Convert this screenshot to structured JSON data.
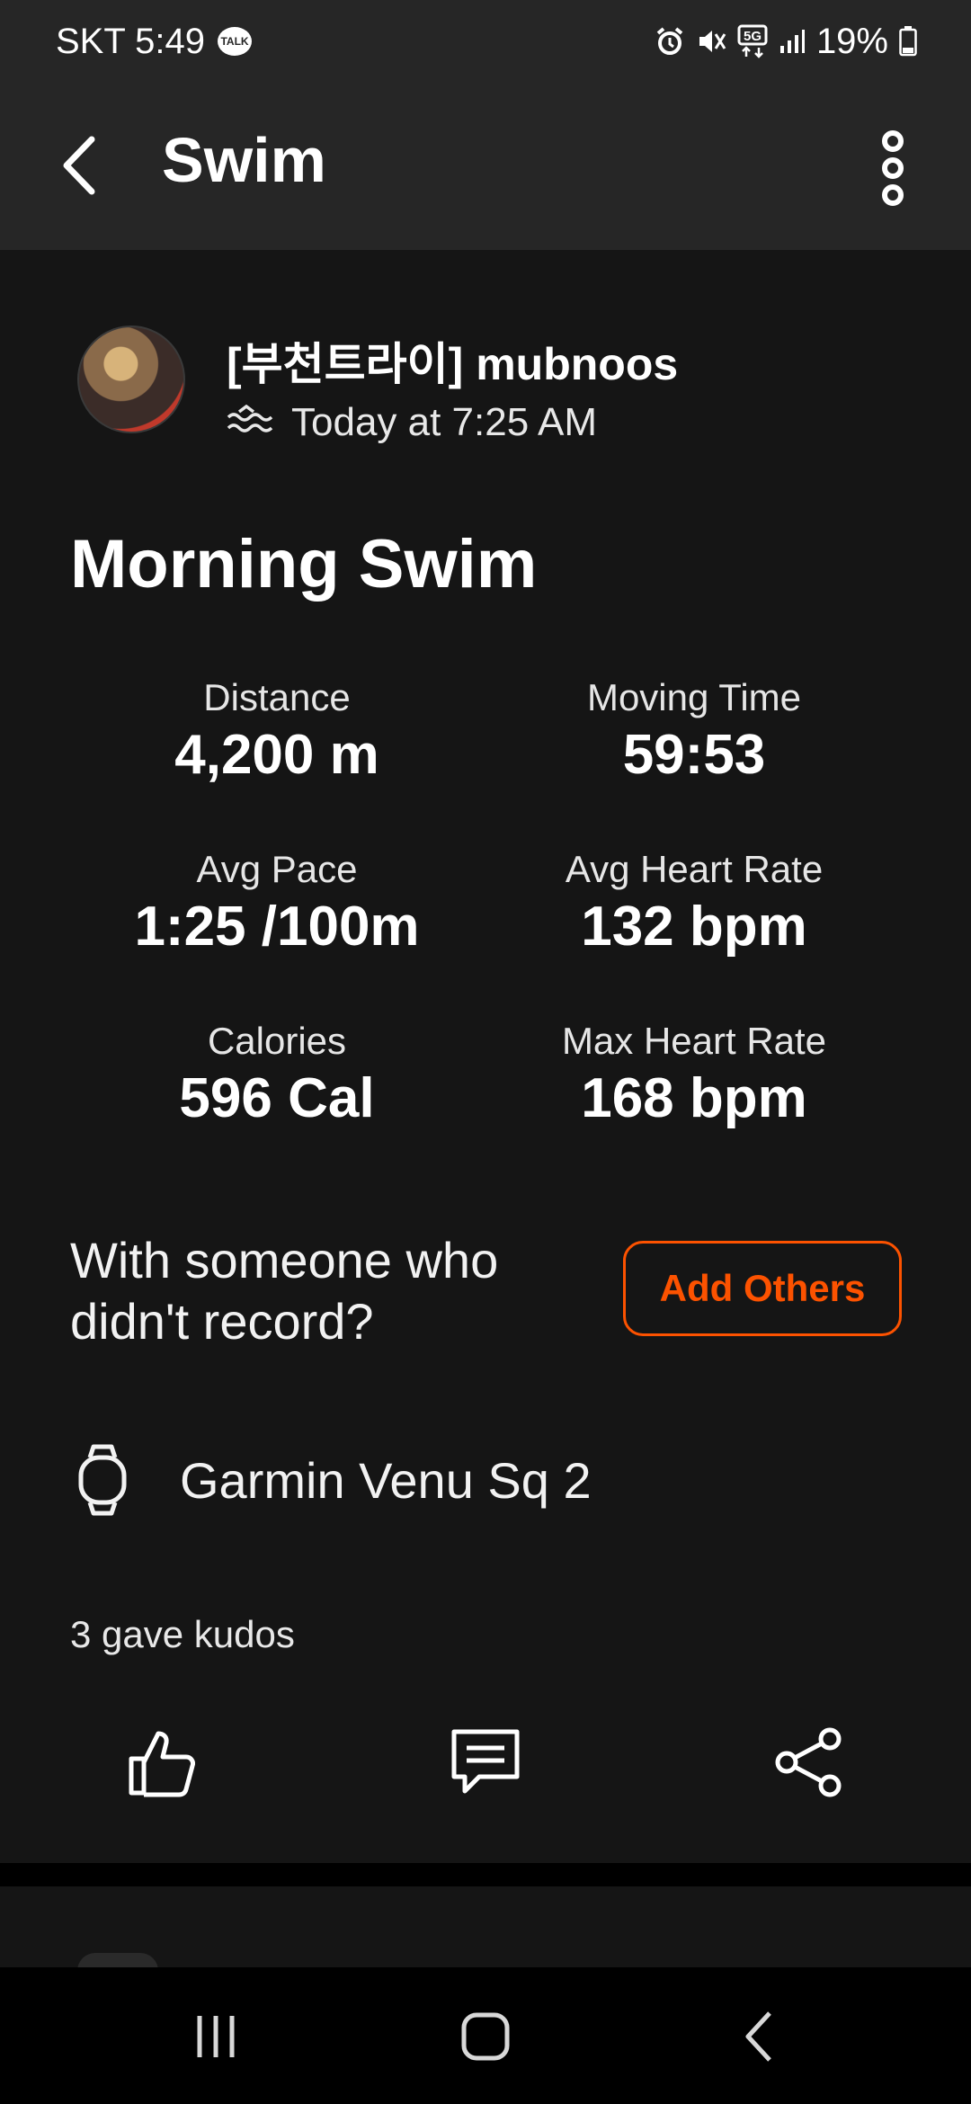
{
  "status_bar": {
    "carrier_time": "SKT 5:49",
    "talk_badge": "TALK",
    "battery": "19%",
    "icons": [
      "alarm-icon",
      "mute-icon",
      "5g-icon",
      "signal-icon",
      "battery-icon"
    ]
  },
  "app_bar": {
    "title": "Swim",
    "back_icon": "chevron-left-icon",
    "more_icon": "vertical-dots-icon"
  },
  "activity": {
    "athlete_name": "[부천트라이] mubnoos",
    "sport_icon": "swim-waves-icon",
    "timestamp": "Today at 7:25 AM",
    "title": "Morning Swim"
  },
  "stats": [
    {
      "label": "Distance",
      "value": "4,200 m"
    },
    {
      "label": "Moving Time",
      "value": "59:53"
    },
    {
      "label": "Avg Pace",
      "value": "1:25 /100m"
    },
    {
      "label": "Avg Heart Rate",
      "value": "132 bpm"
    },
    {
      "label": "Calories",
      "value": "596 Cal"
    },
    {
      "label": "Max Heart Rate",
      "value": "168 bpm"
    }
  ],
  "add_others": {
    "prompt": "With someone who didn't record?",
    "button_label": "Add Others"
  },
  "device": {
    "icon": "watch-icon",
    "name": "Garmin Venu Sq 2"
  },
  "kudos": {
    "text": "3 gave kudos"
  },
  "actions": [
    "kudos-thumbs-up-icon",
    "comment-icon",
    "share-icon"
  ],
  "nav_bar": [
    "recents-icon",
    "home-icon",
    "back-icon"
  ],
  "colors": {
    "accent": "#fc5200",
    "background": "#151515",
    "app_bar": "#262626"
  }
}
